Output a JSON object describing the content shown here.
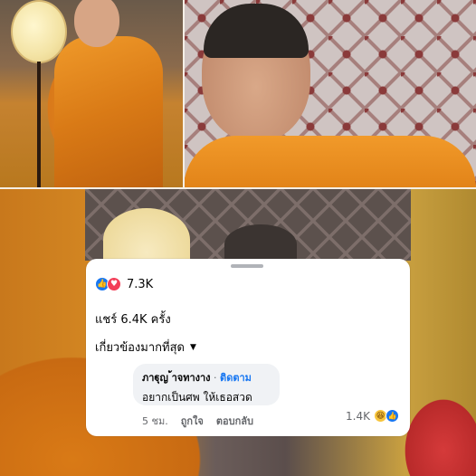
{
  "post": {
    "reactions": {
      "count": "7.3K",
      "types": [
        "like-icon",
        "love-icon"
      ]
    },
    "shares_text": "แชร์ 6.4K ครั้ง",
    "sort_label": "เกี่ยวข้องมากที่สุด"
  },
  "comment": {
    "author": "ภาฐุญ ้าจทางาง",
    "follow_label": "ติดตาม",
    "separator": "·",
    "text": "อยากเป็นศพ ให้เธอสวด",
    "time": "5 ชม.",
    "like_label": "ถูกใจ",
    "reply_label": "ตอบกลับ",
    "reaction_count": "1.4K",
    "reaction_types": [
      "haha-icon",
      "like-icon"
    ]
  },
  "colors": {
    "facebook_blue": "#1877f2",
    "love_red": "#f33e58",
    "haha_yellow": "#f7c53c",
    "robe_orange": "#e28318"
  }
}
